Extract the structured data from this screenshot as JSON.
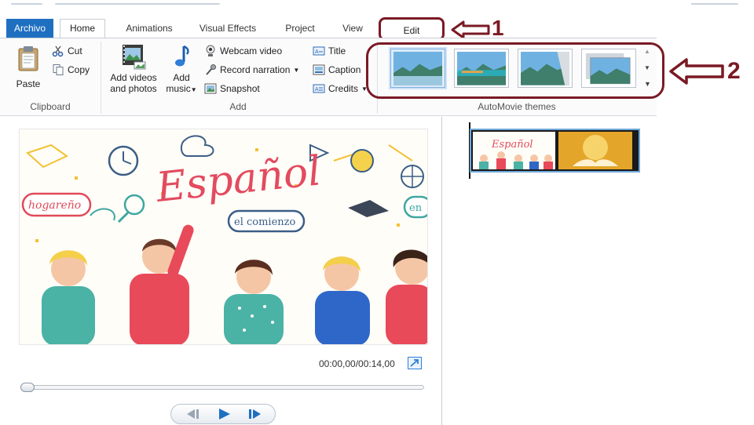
{
  "tabs": {
    "archivo": "Archivo",
    "home": "Home",
    "animations": "Animations",
    "visual_effects": "Visual Effects",
    "project": "Project",
    "view": "View",
    "edit": "Edit"
  },
  "clipboard": {
    "paste": "Paste",
    "cut": "Cut",
    "copy": "Copy",
    "group_label": "Clipboard"
  },
  "add": {
    "add_videos_line1": "Add videos",
    "add_videos_line2": "and photos",
    "add_music_line1": "Add",
    "add_music_line2": "music",
    "webcam_video": "Webcam video",
    "record_narration": "Record narration",
    "snapshot": "Snapshot",
    "title": "Title",
    "caption": "Caption",
    "credits": "Credits",
    "group_label": "Add"
  },
  "themes": {
    "group_label": "AutoMovie themes",
    "selected_index": 0,
    "count": 4
  },
  "callouts": {
    "one": "1",
    "two": "2"
  },
  "preview": {
    "title_text": "Español",
    "badge_hogareno": "hogareño",
    "badge_comienzo": "el comienzo",
    "badge_en": "en",
    "timecode": "00:00,00/00:14,00"
  },
  "storyboard": {
    "clip1_text": "Español"
  },
  "colors": {
    "accent_blue": "#1f6fc1",
    "callout_red": "#7a1a24",
    "selection_blue": "#cfe2f6"
  }
}
